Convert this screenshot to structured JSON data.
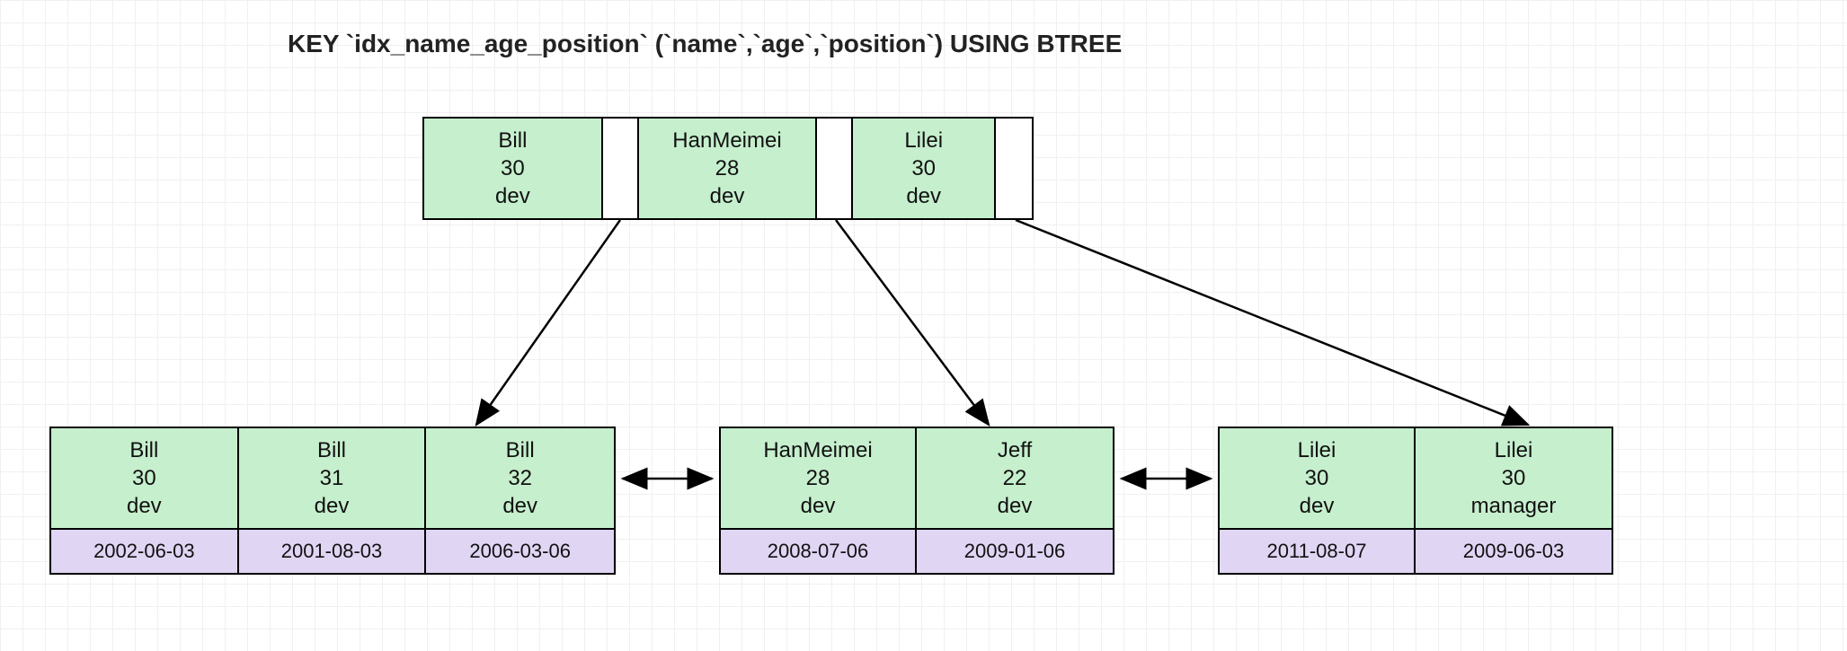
{
  "title": "KEY `idx_name_age_position` (`name`,`age`,`position`) USING BTREE",
  "root": {
    "keys": [
      {
        "name": "Bill",
        "age": "30",
        "position": "dev"
      },
      {
        "name": "HanMeimei",
        "age": "28",
        "position": "dev"
      },
      {
        "name": "Lilei",
        "age": "30",
        "position": "dev"
      }
    ]
  },
  "leaves": [
    {
      "keys": [
        {
          "name": "Bill",
          "age": "30",
          "position": "dev"
        },
        {
          "name": "Bill",
          "age": "31",
          "position": "dev"
        },
        {
          "name": "Bill",
          "age": "32",
          "position": "dev"
        }
      ],
      "dates": [
        "2002-06-03",
        "2001-08-03",
        "2006-03-06"
      ]
    },
    {
      "keys": [
        {
          "name": "HanMeimei",
          "age": "28",
          "position": "dev"
        },
        {
          "name": "Jeff",
          "age": "22",
          "position": "dev"
        }
      ],
      "dates": [
        "2008-07-06",
        "2009-01-06"
      ]
    },
    {
      "keys": [
        {
          "name": "Lilei",
          "age": "30",
          "position": "dev"
        },
        {
          "name": "Lilei",
          "age": "30",
          "position": "manager"
        }
      ],
      "dates": [
        "2011-08-07",
        "2009-06-03"
      ]
    }
  ],
  "colors": {
    "key_bg": "#c6efce",
    "ptr_bg": "#ffffff",
    "date_bg": "#e1d5f4"
  }
}
